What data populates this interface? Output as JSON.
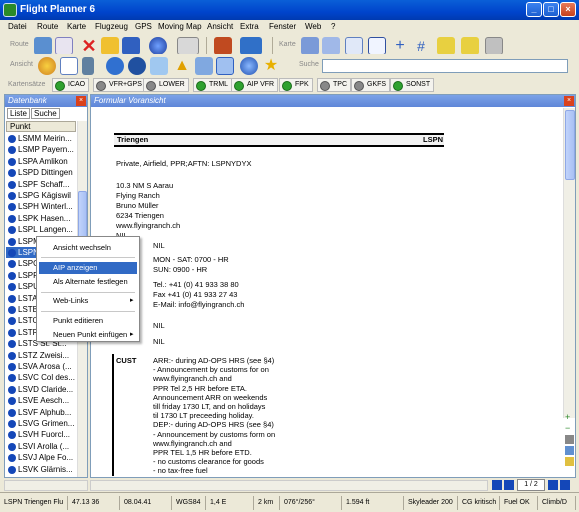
{
  "window": {
    "title": "Flight Planner 6"
  },
  "menu": [
    "Datei",
    "Route",
    "Karte",
    "Flugzeug",
    "GPS",
    "Moving Map",
    "Ansicht",
    "Extra",
    "Fenster",
    "Web",
    "?"
  ],
  "toolbar": {
    "route_label": "Route",
    "karte_label": "Karte",
    "ansicht_label": "Ansicht",
    "suche_label": "Suche",
    "search_value": ""
  },
  "chartbar": {
    "label": "Kartensätze",
    "items": [
      "ICAO",
      "VFR+GPS",
      "LOWER",
      "TRML",
      "AIP VFR",
      "FPK",
      "TPC",
      "GKFS",
      "SONST"
    ]
  },
  "left_panel": {
    "title": "Datenbank",
    "tabs": [
      "Liste",
      "Suche"
    ],
    "column": "Punkt",
    "rows": [
      "LSMM Meirin...",
      "LSMP Payern...",
      "LSPA Amlikon",
      "LSPD Dittingen",
      "LSPF Schaff...",
      "LSPG Kägiswil",
      "LSPH Winterl...",
      "LSPK Hasen...",
      "LSPL Langen...",
      "LSPM",
      "LSPN",
      "LSPO",
      "LSPR",
      "LSPU",
      "LSTA",
      "LSTB",
      "LSTO",
      "LSTR",
      "LSTS St. St...",
      "LSTZ Zweisi...",
      "LSVA Arosa (...",
      "LSVC Col des...",
      "LSVD Claride...",
      "LSVE Aesch...",
      "LSVF Alphub...",
      "LSVG Grimen...",
      "LSVH Fuorcl...",
      "LSVI Arolla (...",
      "LSVJ Alpe Fo...",
      "LSVK Glärnis..."
    ]
  },
  "context_menu": {
    "items": [
      "Ansicht wechseln",
      "AIP anzeigen",
      "Als Alternate festlegen",
      "Web-Links",
      "Punkt editieren",
      "Neuen Punkt einfügen"
    ]
  },
  "right_panel": {
    "title": "Formular Voransicht",
    "header_name": "Triengen",
    "header_code": "LSPN",
    "line1": "Private, Airfield, PPR;AFTN: LSPNYDYX",
    "address": [
      "10.3 NM S Aarau",
      "Flying Ranch",
      "Bruno Müller",
      "6234 Triengen",
      "www.flyingranch.ch",
      "NIL"
    ],
    "nil1": "NIL",
    "hours": [
      "MON - SAT: 0700 - HR",
      "SUN: 0900 - HR"
    ],
    "contact": [
      "Tel.: +41 (0) 41 933 38 80",
      "Fax +41 (0) 41 933 27 43",
      "E-Mail: info@flyingranch.ch"
    ],
    "nil2": "NIL",
    "nil3": "NIL",
    "cust_label": "CUST",
    "cust_text": [
      "ARR:- during AD-OPS HRS (see §4)",
      "- Announcement by customs for on",
      "www.flyingranch.ch and",
      "PPR Tel 2,5 HR before ETA.",
      "Announcement ARR on weekends",
      "till friday 1730 LT, and on holidays",
      "til 1730 LT preceeding holiday.",
      "DEP:- during AD-OPS HRS (see §4)",
      "- Announcement by customs form on",
      "www.flyingranch.ch and",
      "PPR TEL 1,5 HR before ETD.",
      "- no customs clearance for goods",
      "- no tax-free fuel"
    ],
    "page_indicator": "1 / 2"
  },
  "status_bar": {
    "cells": [
      "LSPN Triengen Flu",
      "47.13 36",
      "08.04.41",
      "WGS84",
      "1,4 E",
      "2 km",
      "076°/256°",
      "1.594 ft",
      "Skyleader 200",
      "CG kritisch",
      "Fuel OK",
      "Climb/D"
    ]
  }
}
